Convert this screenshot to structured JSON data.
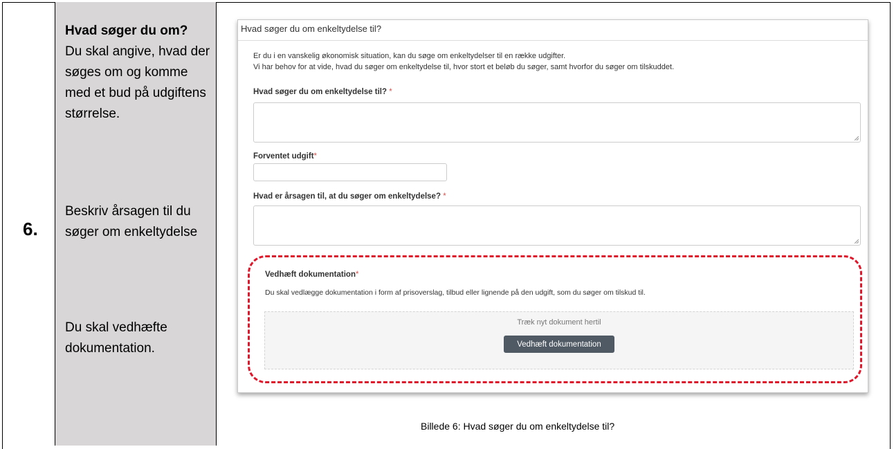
{
  "step": {
    "number": "6."
  },
  "instructions": {
    "block1_title": "Hvad søger du om?",
    "block1_text": "Du skal angive, hvad der søges om og komme med et bud på udgiftens størrelse.",
    "block2_text": "Beskriv årsagen til du søger om enkeltydelse",
    "block3_text": "Du skal vedhæfte dokumentation."
  },
  "form": {
    "header": "Hvad søger du om enkeltydelse til?",
    "intro_line1": "Er du i en vanskelig økonomisk situation, kan du søge om enkeltydelser til en række udgifter.",
    "intro_line2": "Vi har behov for at vide, hvad du søger om enkeltydelse til, hvor stort et beløb du søger, samt hvorfor du søger om tilskuddet.",
    "q1_label": "Hvad søger du om enkeltydelse til?",
    "q1_required": "*",
    "q1_value": "",
    "q2_label": "Forventet udgift",
    "q2_required": "*",
    "q2_value": "",
    "q3_label": "Hvad er årsagen til, at du søger om enkeltydelse?",
    "q3_required": "*",
    "q3_value": "",
    "attach_label": "Vedhæft dokumentation",
    "attach_required": "*",
    "attach_desc": "Du skal vedlægge dokumentation i form af prisoverslag, tilbud eller lignende på den udgift, som du søger om tilskud til.",
    "dropzone_text": "Træk nyt dokument hertil",
    "attach_button": "Vedhæft dokumentation"
  },
  "caption": "Billede 6: Hvad søger du om enkeltydelse til?",
  "colors": {
    "highlight": "#e0162b",
    "sidebar": "#d8d6d6",
    "button": "#505a64",
    "required": "#d9534f"
  }
}
